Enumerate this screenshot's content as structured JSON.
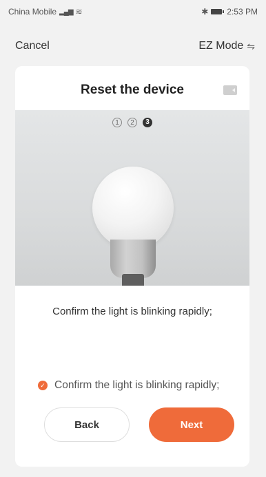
{
  "status_bar": {
    "carrier": "China Mobile",
    "signal_icon": "signal-icon",
    "wifi_icon": "wifi-icon",
    "bluetooth_icon": "bluetooth-icon",
    "battery_icon": "battery-icon",
    "time": "2:53 PM"
  },
  "header": {
    "cancel_label": "Cancel",
    "mode_label": "EZ Mode",
    "mode_icon": "swap-icon"
  },
  "card": {
    "title": "Reset the device",
    "video_icon": "video-icon",
    "steps": [
      "1",
      "2",
      "3"
    ],
    "active_step": 3,
    "instruction": "Confirm the light is blinking rapidly;",
    "confirm_label": "Confirm the light is blinking rapidly;",
    "confirm_checked": true,
    "back_label": "Back",
    "next_label": "Next"
  },
  "colors": {
    "accent": "#ef6b3a",
    "background": "#f2f2f2",
    "card": "#ffffff"
  }
}
